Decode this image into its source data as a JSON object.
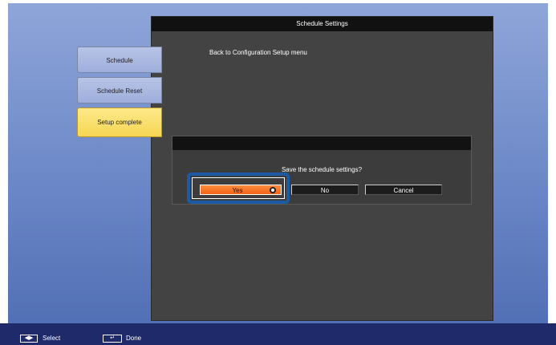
{
  "window": {
    "title": "Schedule Settings"
  },
  "main": {
    "back_link": "Back to Configuration Setup menu"
  },
  "menu": {
    "items": [
      {
        "label": "Schedule"
      },
      {
        "label": "Schedule Reset"
      },
      {
        "label": "Setup complete"
      }
    ]
  },
  "dialog": {
    "message": "Save the schedule settings?",
    "buttons": {
      "yes": "Yes",
      "no": "No",
      "cancel": "Cancel"
    }
  },
  "statusbar": {
    "select_key": "◀▶",
    "select_label": "Select",
    "done_key": "↵",
    "done_label": "Done"
  },
  "colors": {
    "background_blue": "#6a86c6",
    "panel": "#434343",
    "menu_blue": "#9eaedc",
    "menu_yellow": "#f6d653",
    "yes_orange": "#f26418",
    "focus_ring": "#1c5aa4",
    "statusbar": "#1e2a6a"
  },
  "icons": {
    "enter": "enter-icon",
    "left_right": "left-right-arrows-icon",
    "return": "return-key-icon"
  }
}
